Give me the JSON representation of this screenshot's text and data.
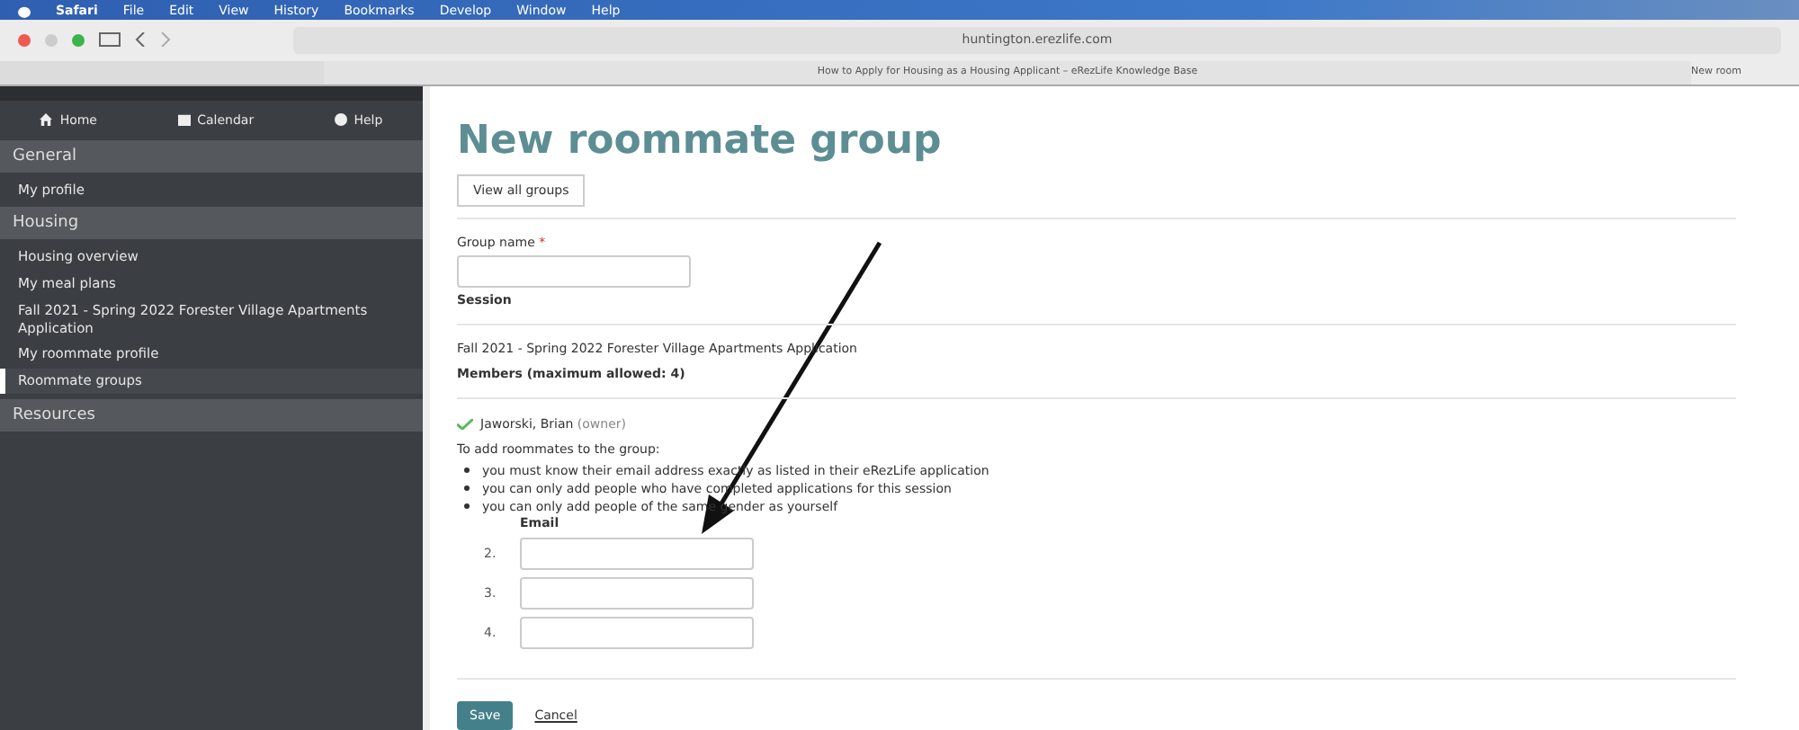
{
  "menu_bar": {
    "items": [
      "Safari",
      "File",
      "Edit",
      "View",
      "History",
      "Bookmarks",
      "Develop",
      "Window",
      "Help"
    ]
  },
  "toolbar": {
    "address": "huntington.erezlife.com"
  },
  "tabs": [
    {
      "label": "How to Apply for Housing as a Housing Applicant – eRezLife Knowledge Base",
      "selected": false
    },
    {
      "label": "New room",
      "selected": true
    }
  ],
  "sidebar": {
    "nav": [
      {
        "kind": "home",
        "label": "Home"
      },
      {
        "kind": "calendar",
        "label": "Calendar"
      },
      {
        "kind": "help",
        "label": "Help"
      }
    ],
    "sections": [
      {
        "title": "General",
        "items": [
          {
            "label": "My profile",
            "selected": false
          }
        ]
      },
      {
        "title": "Housing",
        "items": [
          {
            "label": "Housing overview",
            "selected": false
          },
          {
            "label": "My meal plans",
            "selected": false
          },
          {
            "label": "Fall 2021 - Spring 2022 Forester Village Apartments Application",
            "selected": false
          },
          {
            "label": "My roommate profile",
            "selected": false
          },
          {
            "label": "Roommate groups",
            "selected": true
          }
        ]
      },
      {
        "title": "Resources"
      }
    ]
  },
  "page": {
    "title": "New roommate group",
    "view_button": "View all groups",
    "group_name_label": "Group name",
    "required_mark": "*",
    "session_label": "Session",
    "session_value": "Fall 2021 - Spring 2022 Forester Village Apartments Application",
    "members_label": "Members (maximum allowed: 4)",
    "owner": {
      "name": "Jaworski, Brian",
      "role": "(owner)"
    },
    "instructions": "To add roommates to the group:",
    "rules": [
      "you must know their email address exactly as listed in their eRezLife application",
      "you can only add people who have completed applications for this session",
      "you can only add people of the same gender as yourself"
    ],
    "email_label": "Email",
    "email_rows": [
      {
        "number": "2."
      },
      {
        "number": "3."
      },
      {
        "number": "4."
      }
    ],
    "save": "Save",
    "cancel": "Cancel"
  }
}
